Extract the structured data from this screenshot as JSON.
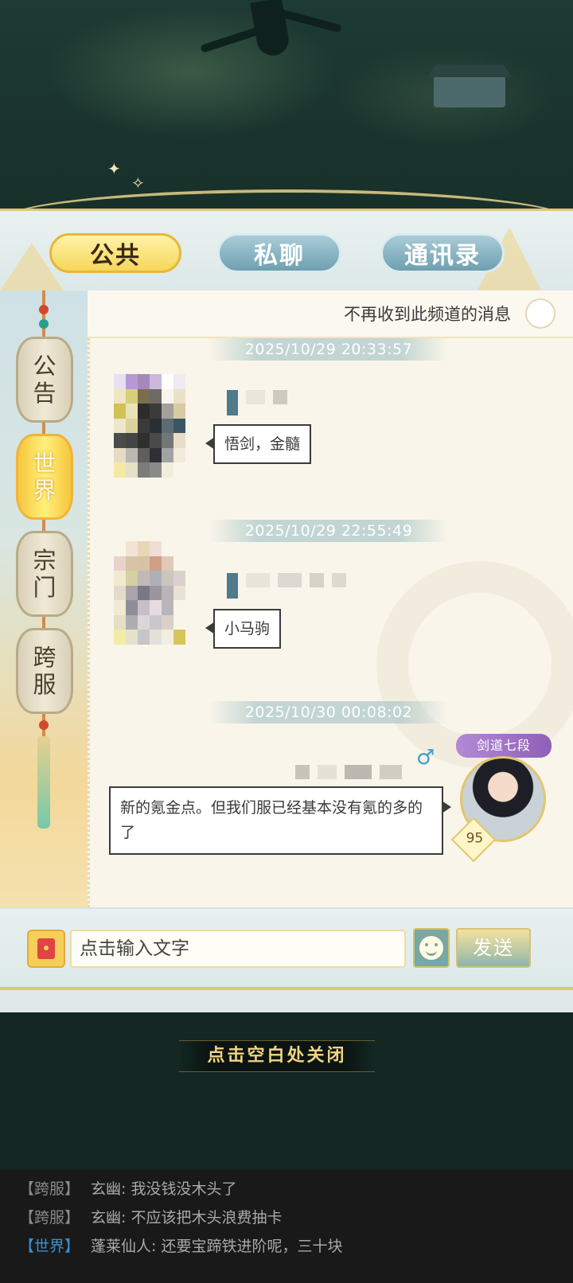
{
  "tabs": [
    {
      "label": "公共",
      "active": true
    },
    {
      "label": "私聊",
      "active": false
    },
    {
      "label": "通讯录",
      "active": false
    }
  ],
  "sidebar": {
    "items": [
      {
        "label_top": "公",
        "label_bottom": "告",
        "active": false
      },
      {
        "label_top": "世",
        "label_bottom": "界",
        "active": true
      },
      {
        "label_top": "宗",
        "label_bottom": "门",
        "active": false
      },
      {
        "label_top": "跨",
        "label_bottom": "服",
        "active": false
      }
    ]
  },
  "channel_option": {
    "label": "不再收到此频道的消息",
    "checked": false
  },
  "messages": [
    {
      "timestamp": "2025/10/29  20:33:57",
      "text": "悟剑，金髓",
      "self": false
    },
    {
      "timestamp": "2025/10/29  22:55:49",
      "text": "小马驹",
      "self": false
    },
    {
      "timestamp": "2025/10/30  00:08:02",
      "text": "新的氪金点。但我们服已经基本没有氪的多的了",
      "self": true,
      "gender_icon": "♂",
      "rank_badge": "剑道七段",
      "level": "95"
    }
  ],
  "input": {
    "placeholder": "点击输入文字",
    "value": ""
  },
  "send_button": "发送",
  "close_hint": "点击空白处关闭",
  "ticker": [
    {
      "channel": "【跨服】",
      "speaker": "玄幽",
      "text": "我没钱没木头了",
      "channel_color": "#8a8a8a"
    },
    {
      "channel": "【跨服】",
      "speaker": "玄幽",
      "text": "不应该把木头浪费抽卡",
      "channel_color": "#8a8a8a"
    },
    {
      "channel": "【世界】",
      "speaker": "蓬莱仙人",
      "text": "还要宝蹄铁进阶呢，三十块",
      "channel_color": "#3a8fd6"
    }
  ],
  "icons": {
    "redpacket": "red-envelope-icon",
    "emoji": "smiley-icon",
    "gender": "male-icon"
  },
  "colors": {
    "accent_gold": "#f7d75a",
    "tab_inactive": "#6f9fb0",
    "world_channel": "#3a8fd6"
  }
}
